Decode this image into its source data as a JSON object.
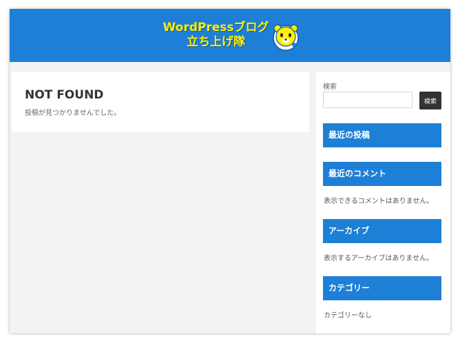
{
  "header": {
    "logo_line1": "WordPressブログ",
    "logo_line2": "立ち上げ隊",
    "colors": {
      "header_bg": "#1e7fd6",
      "logo_text": "#ffef00"
    }
  },
  "main": {
    "title": "NOT FOUND",
    "message": "投稿が見つかりませんでした。"
  },
  "sidebar": {
    "search": {
      "label": "検索",
      "input_value": "",
      "button_label": "検索"
    },
    "widgets": [
      {
        "title": "最近の投稿",
        "text": ""
      },
      {
        "title": "最近のコメント",
        "text": "表示できるコメントはありません。"
      },
      {
        "title": "アーカイブ",
        "text": "表示するアーカイブはありません。"
      },
      {
        "title": "カテゴリー",
        "text": "カテゴリーなし"
      }
    ],
    "colors": {
      "widget_title_bg": "#1e7fd6",
      "search_button_bg": "#333333"
    }
  }
}
